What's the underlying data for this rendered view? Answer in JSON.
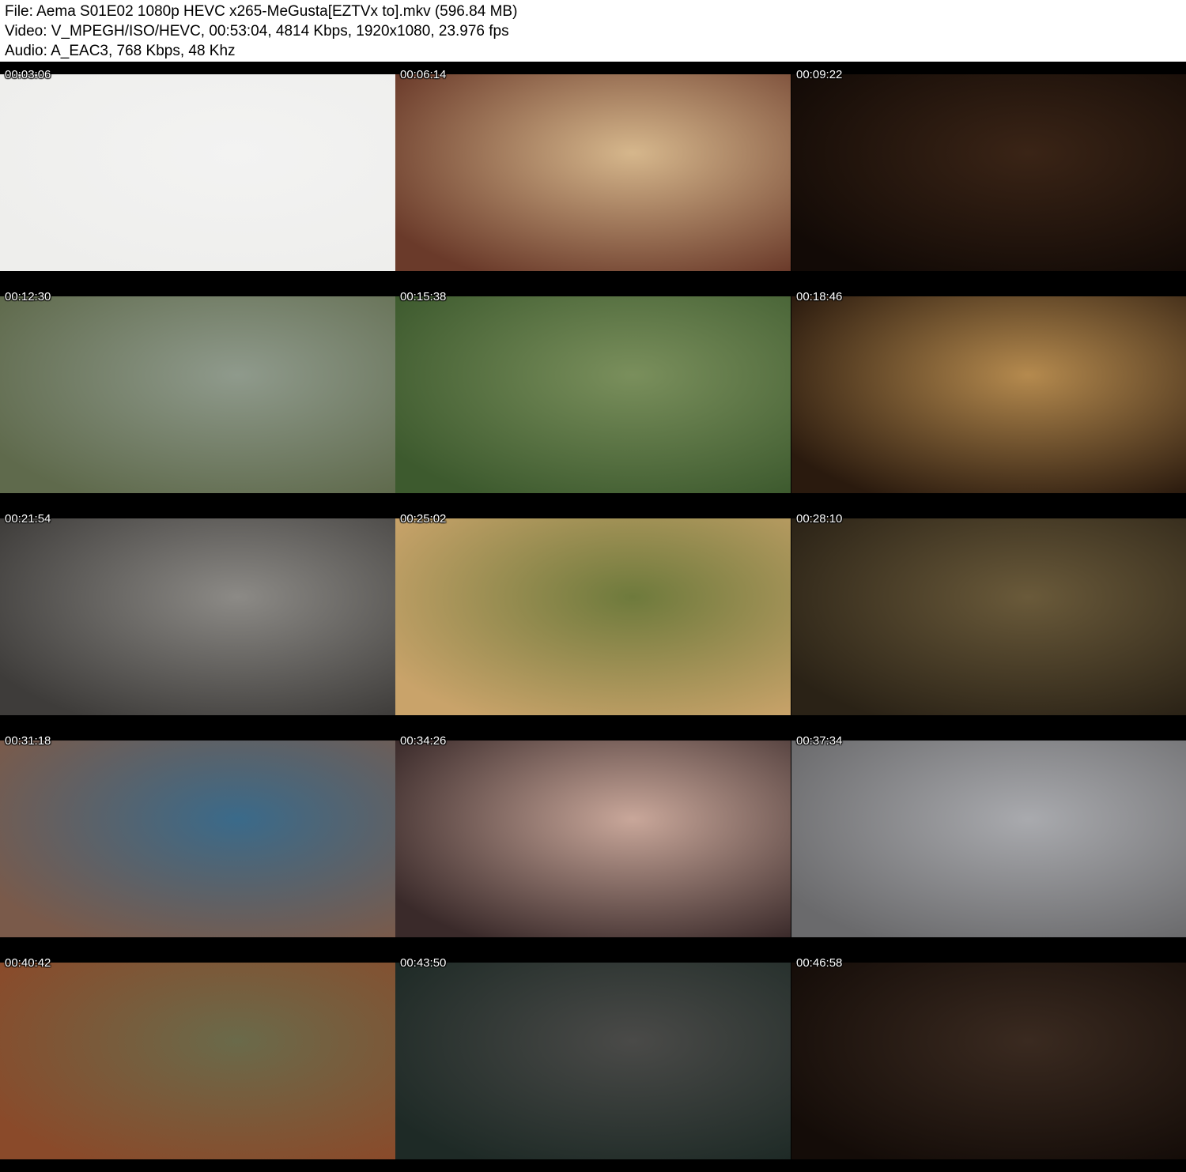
{
  "header": {
    "file": "File: Aema S01E02 1080p HEVC x265-MeGusta[EZTVx to].mkv (596.84 MB)",
    "video": "Video: V_MPEGH/ISO/HEVC, 00:53:04, 4814 Kbps, 1920x1080, 23.976 fps",
    "audio": "Audio: A_EAC3, 768 Kbps, 48 Khz"
  },
  "thumbnails": [
    {
      "time": "00:03:06",
      "colors": [
        "#f3f3f2",
        "#eeeeec"
      ]
    },
    {
      "time": "00:06:14",
      "colors": [
        "#d6b78c",
        "#6a3a2a"
      ]
    },
    {
      "time": "00:09:22",
      "colors": [
        "#3a2416",
        "#120a06"
      ]
    },
    {
      "time": "00:12:30",
      "colors": [
        "#8f9a8c",
        "#5f6a4c"
      ]
    },
    {
      "time": "00:15:38",
      "colors": [
        "#7a8f5c",
        "#3d5a2e"
      ]
    },
    {
      "time": "00:18:46",
      "colors": [
        "#b58a4e",
        "#2a1a0e"
      ]
    },
    {
      "time": "00:21:54",
      "colors": [
        "#8c8a86",
        "#3e3c3a"
      ]
    },
    {
      "time": "00:25:02",
      "colors": [
        "#6e7a3c",
        "#c9a36a"
      ]
    },
    {
      "time": "00:28:10",
      "colors": [
        "#6a5a3a",
        "#2a2216"
      ]
    },
    {
      "time": "00:31:18",
      "colors": [
        "#3a6a8a",
        "#7a5a4a"
      ]
    },
    {
      "time": "00:34:26",
      "colors": [
        "#c9a79a",
        "#3a2a2a"
      ]
    },
    {
      "time": "00:37:34",
      "colors": [
        "#a9aaae",
        "#6a6a6c"
      ]
    },
    {
      "time": "00:40:42",
      "colors": [
        "#6a6a4a",
        "#8a4a2a"
      ]
    },
    {
      "time": "00:43:50",
      "colors": [
        "#4a4a48",
        "#1e2a26"
      ]
    },
    {
      "time": "00:46:58",
      "colors": [
        "#3a2a20",
        "#140c08"
      ]
    }
  ]
}
